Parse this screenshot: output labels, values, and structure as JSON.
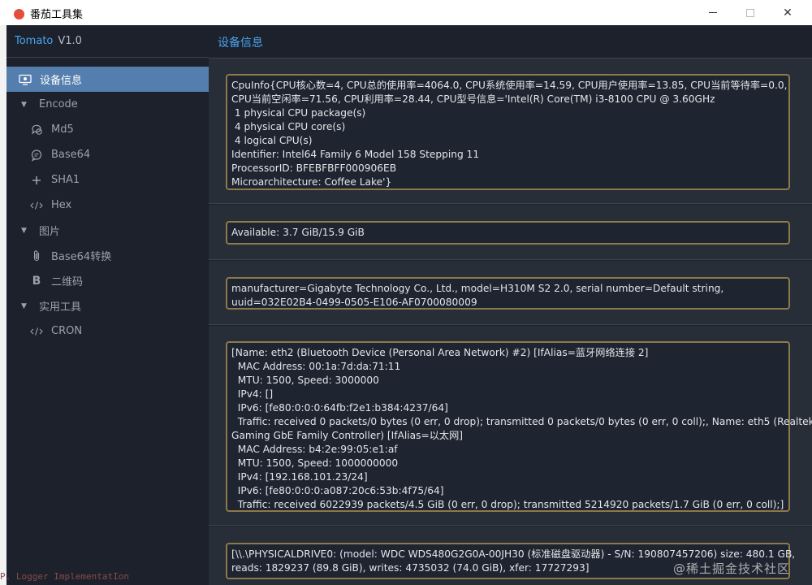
{
  "window": {
    "title": "番茄工具集",
    "controls": {
      "minimize": "minimize",
      "maximize": "maximize",
      "close": "✕"
    }
  },
  "sidebar": {
    "brand": "Tomato",
    "version": "V1.0",
    "items": [
      {
        "label": "设备信息",
        "icon": "monitor-icon",
        "active": true,
        "level": 0
      },
      {
        "label": "Encode",
        "icon": "caret-down-icon",
        "level": 1,
        "group": true
      },
      {
        "label": "Md5",
        "icon": "hash-bubble-icon",
        "level": 2
      },
      {
        "label": "Base64",
        "icon": "chat-icon",
        "level": 2
      },
      {
        "label": "SHA1",
        "icon": "plus-icon",
        "level": 2
      },
      {
        "label": "Hex",
        "icon": "code-icon",
        "level": 2
      },
      {
        "label": "图片",
        "icon": "caret-down-icon",
        "level": 1,
        "group": true
      },
      {
        "label": "Base64转换",
        "icon": "paperclip-icon",
        "level": 2
      },
      {
        "label": "二维码",
        "icon": "bold-b-icon",
        "level": 2
      },
      {
        "label": "实用工具",
        "icon": "caret-down-icon",
        "level": 1,
        "group": true
      },
      {
        "label": "CRON",
        "icon": "code-icon",
        "level": 2
      }
    ]
  },
  "main": {
    "title": "设备信息",
    "panels": [
      {
        "name": "cpu-info",
        "lines": [
          "CpuInfo{CPU核心数=4, CPU总的使用率=4064.0, CPU系统使用率=14.59, CPU用户使用率=13.85, CPU当前等待率=0.0,",
          "CPU当前空闲率=71.56, CPU利用率=28.44, CPU型号信息='Intel(R) Core(TM) i3-8100 CPU @ 3.60GHz",
          " 1 physical CPU package(s)",
          " 4 physical CPU core(s)",
          " 4 logical CPU(s)",
          "Identifier: Intel64 Family 6 Model 158 Stepping 11",
          "ProcessorID: BFEBFBFF000906EB",
          "Microarchitecture: Coffee Lake'}"
        ]
      },
      {
        "name": "memory-info",
        "lines": [
          "Available: 3.7 GiB/15.9 GiB"
        ]
      },
      {
        "name": "board-info",
        "lines": [
          "manufacturer=Gigabyte Technology Co., Ltd., model=H310M S2 2.0, serial number=Default string,",
          "uuid=032E02B4-0499-0505-E106-AF0700080009"
        ]
      },
      {
        "name": "network-info",
        "lines": [
          "[Name: eth2 (Bluetooth Device (Personal Area Network) #2) [IfAlias=蓝牙网络连接 2]",
          "  MAC Address: 00:1a:7d:da:71:11",
          "  MTU: 1500, Speed: 3000000",
          "  IPv4: []",
          "  IPv6: [fe80:0:0:0:64fb:f2e1:b384:4237/64]",
          "  Traffic: received 0 packets/0 bytes (0 err, 0 drop); transmitted 0 packets/0 bytes (0 err, 0 coll);, Name: eth5 (Realtek",
          "Gaming GbE Family Controller) [IfAlias=以太网]",
          "  MAC Address: b4:2e:99:05:e1:af",
          "  MTU: 1500, Speed: 1000000000",
          "  IPv4: [192.168.101.23/24]",
          "  IPv6: [fe80:0:0:0:a087:20c6:53b:4f75/64]",
          "  Traffic: received 6022939 packets/4.5 GiB (0 err, 0 drop); transmitted 5214920 packets/1.7 GiB (0 err, 0 coll);]"
        ]
      },
      {
        "name": "disk-info",
        "lines": [
          "[\\\\.\\PHYSICALDRIVE0: (model: WDC WDS480G2G0A-00JH30 (标准磁盘驱动器) - S/N: 190807457206) size: 480.1 GB,",
          "reads: 1829237 (89.8 GiB), writes: 4735032 (74.0 GiB), xfer: 17727293]"
        ]
      }
    ]
  },
  "watermark": "@稀土掘金技术社区",
  "background_text": "P. Logger  ImplementatIon"
}
